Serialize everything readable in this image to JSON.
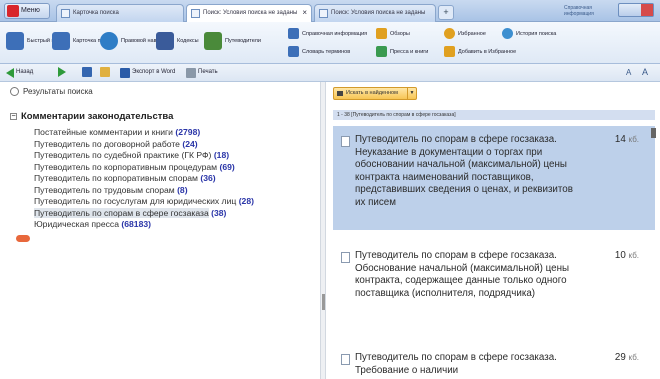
{
  "app": {
    "menu_label": "Меню",
    "tabs": [
      {
        "label": "Карточка поиска",
        "active": false
      },
      {
        "label": "Поиск: Условия поиска не заданы",
        "active": true
      },
      {
        "label": "Поиск: Условия поиска не заданы",
        "active": false
      }
    ],
    "newtab_symbol": "+",
    "close_symbol": "×",
    "topright_label": "Справочная информация"
  },
  "ribbon": {
    "buttons": [
      {
        "label": "Быстрый поиск",
        "color": "#3d6fb8"
      },
      {
        "label": "Карточка поиска",
        "color": "#3d6fb8"
      },
      {
        "label": "Правовой навигатор",
        "color": "#2e7dc6"
      },
      {
        "label": "Кодексы",
        "color": "#3a5b9a"
      },
      {
        "label": "Путеводители",
        "color": "#4a8a3a"
      }
    ],
    "small_buttons": [
      {
        "label": "Справочная информация",
        "color": "#3d6fb8"
      },
      {
        "label": "Словарь терминов",
        "color": "#3d6fb8"
      },
      {
        "label": "Обзоры",
        "color": "#e0a020"
      },
      {
        "label": "Пресса и книги",
        "color": "#3a9a50"
      },
      {
        "label": "Избранное",
        "color": "#e0a020"
      },
      {
        "label": "Добавить в Избранное",
        "color": "#e0a020"
      },
      {
        "label": "История поиска",
        "color": "#3d8fd0"
      }
    ]
  },
  "navbar": {
    "back_label": "Назад",
    "export_label": "Экспорт в Word",
    "print_label": "Печать"
  },
  "left": {
    "results_title": "Результаты поиска",
    "group_title": "Комментарии законодательства",
    "items": [
      {
        "label": "Постатейные комментарии и книги",
        "count": "(2798)",
        "selected": false
      },
      {
        "label": "Путеводитель по договорной работе",
        "count": "(24)",
        "selected": false
      },
      {
        "label": "Путеводитель по судебной практике (ГК РФ)",
        "count": "(18)",
        "selected": false
      },
      {
        "label": "Путеводитель по корпоративным процедурам",
        "count": "(69)",
        "selected": false
      },
      {
        "label": "Путеводитель по корпоративным спорам",
        "count": "(36)",
        "selected": false
      },
      {
        "label": "Путеводитель по трудовым спорам",
        "count": "(8)",
        "selected": false
      },
      {
        "label": "Путеводитель по госуслугам для юридических лиц",
        "count": "(28)",
        "selected": false
      },
      {
        "label": "Путеводитель по спорам в сфере госзаказа",
        "count": "(38)",
        "selected": true
      },
      {
        "label": "Юридическая пресса",
        "count": "(68183)",
        "selected": false
      }
    ]
  },
  "right": {
    "search_button_label": "Искать в найденном",
    "info_line": "1 - 38 [Путеводитель по спорам в сфере госзаказа]",
    "documents": [
      {
        "text": "Путеводитель по спорам в сфере госзаказа. Неуказание в документации о торгах при обосновании начальной (максимальной) цены контракта наименований поставщиков, представивших сведения о ценах, и реквизитов их писем",
        "size": "14",
        "unit": "кб.",
        "selected": true
      },
      {
        "text": "Путеводитель по спорам в сфере госзаказа. Обоснование начальной (максимальной) цены контракта, содержащее данные только одного поставщика (исполнителя, подрядчика)",
        "size": "10",
        "unit": "кб.",
        "selected": false
      },
      {
        "text": "Путеводитель по спорам в сфере госзаказа. Требование о наличии",
        "size": "29",
        "unit": "кб.",
        "selected": false
      }
    ]
  },
  "colors": {
    "accent_blue": "#bdd0ea",
    "count_color": "#2a35a8",
    "bullet_orange": "#e8683c"
  }
}
